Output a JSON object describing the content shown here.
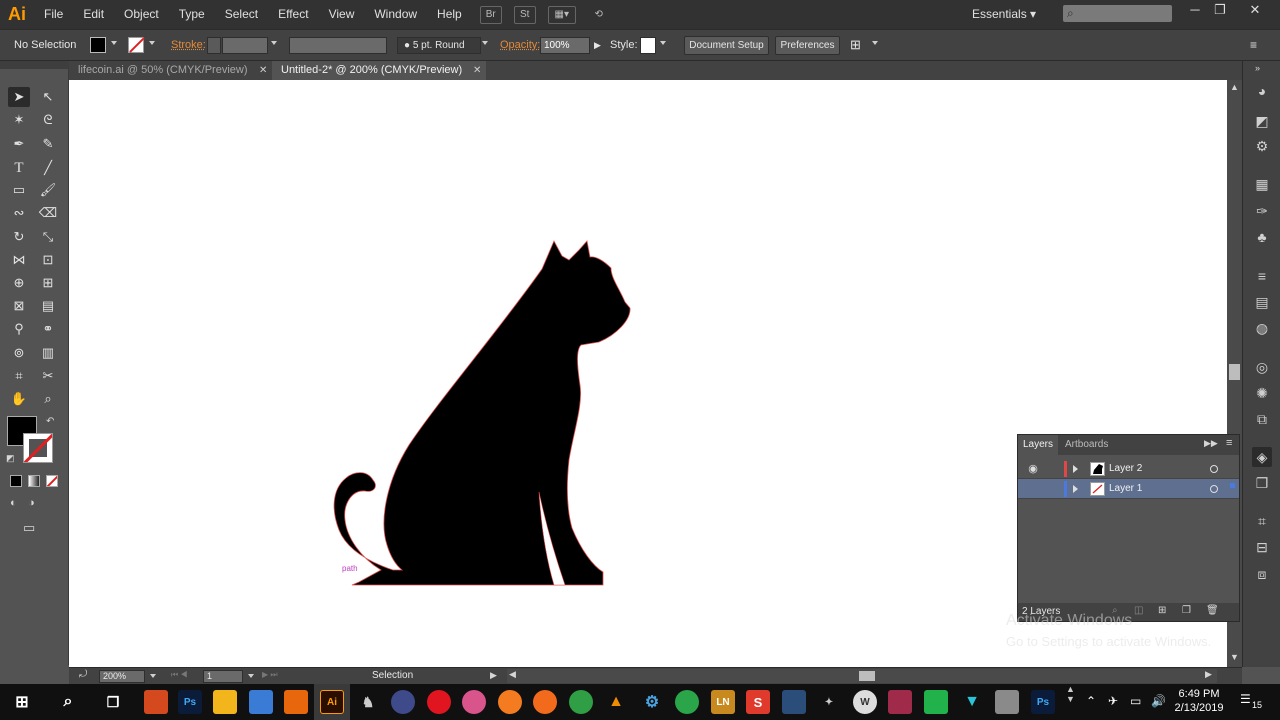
{
  "app": {
    "logo": "Ai"
  },
  "menu": [
    "File",
    "Edit",
    "Object",
    "Type",
    "Select",
    "Effect",
    "View",
    "Window",
    "Help"
  ],
  "menubar_icons": {
    "bridge": "Br",
    "stock": "St",
    "arrange": "arrange-documents-icon",
    "gpu": "gpu-performance-icon"
  },
  "workspace": {
    "label": "Essentials"
  },
  "control": {
    "selection": "No Selection",
    "stroke_label": "Stroke:",
    "brush": "5 pt. Round",
    "opacity_label": "Opacity:",
    "opacity_value": "100%",
    "style_label": "Style:",
    "document_setup": "Document Setup",
    "preferences": "Preferences"
  },
  "tabs": [
    {
      "title": "lifecoin.ai @ 50% (CMYK/Preview)",
      "active": false
    },
    {
      "title": "Untitled-2* @ 200% (CMYK/Preview)",
      "active": true
    }
  ],
  "canvas": {
    "hover_label": "path",
    "artwork": "cat-silhouette"
  },
  "statusbar": {
    "zoom": "200%",
    "artboard": "1",
    "tool": "Selection"
  },
  "layers_panel": {
    "tabs": [
      "Layers",
      "Artboards"
    ],
    "rows": [
      {
        "name": "Layer 2",
        "color": "#e04848",
        "visible": true,
        "selected": false
      },
      {
        "name": "Layer 1",
        "color": "#4a7ae0",
        "visible": false,
        "selected": true
      }
    ],
    "count": "2 Layers"
  },
  "watermark": {
    "title": "Activate Windows",
    "subtitle": "Go to Settings to activate Windows."
  },
  "taskbar": {
    "time": "6:49 PM",
    "date": "2/13/2019",
    "notifications": "15",
    "apps": [
      "Ps",
      "Ai",
      "LN",
      "S",
      "Ps"
    ]
  },
  "colors": {
    "accent": "#ff9a00",
    "stroke_orange": "#e28a3c",
    "artwork": "#000000",
    "path_outline": "#e05050"
  }
}
